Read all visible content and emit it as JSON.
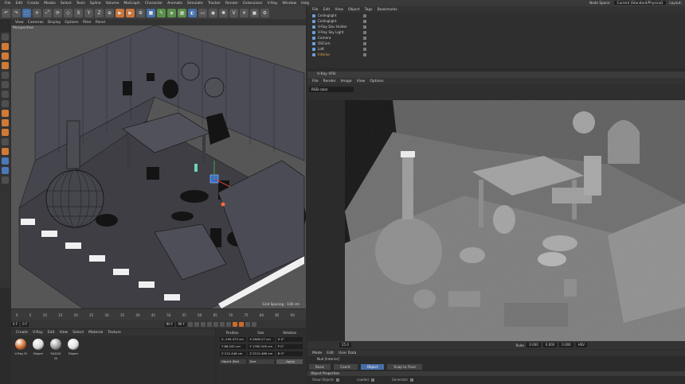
{
  "menu": [
    "File",
    "Edit",
    "Create",
    "Modes",
    "Select",
    "Tools",
    "Spline",
    "Volume",
    "MoGraph",
    "Character",
    "Animate",
    "Simulate",
    "Tracker",
    "Render",
    "Extensions",
    "V-Ray",
    "Window",
    "Help"
  ],
  "node_space": {
    "label": "Node Space:",
    "value": "Current (Standard/Physical)",
    "layout": "Layout:"
  },
  "toolbar": {
    "x": "X",
    "y": "Y",
    "z": "Z"
  },
  "viewport": {
    "menu": [
      "View",
      "Cameras",
      "Display",
      "Options",
      "Filter",
      "Panel"
    ],
    "title": "Perspective",
    "grid_spacing": "Grid Spacing : 100 cm"
  },
  "timeline": {
    "ticks": [
      "0",
      "5",
      "10",
      "15",
      "20",
      "25",
      "30",
      "35",
      "40",
      "45",
      "50",
      "55",
      "60",
      "65",
      "70",
      "75",
      "80",
      "85",
      "90"
    ],
    "start": "0 F",
    "cur": "0 F",
    "end": "90 F",
    "end2": "90 F"
  },
  "materials": {
    "menu": [
      "Create",
      "V-Ray",
      "Edit",
      "View",
      "Select",
      "Material",
      "Texture"
    ],
    "items": [
      {
        "name": "V-Ray M",
        "color": "#c86a2a"
      },
      {
        "name": "Diaper",
        "color": "#d8d8d8"
      },
      {
        "name": "SAXXX Gl",
        "color": "#9a9a9a"
      },
      {
        "name": "Diaper",
        "color": "#e0e0e0"
      }
    ]
  },
  "coords": {
    "headers": [
      "Position",
      "Size",
      "Rotation"
    ],
    "rows": [
      {
        "axis": "X",
        "pos": "-299.473 cm",
        "size": "2608.27 cm",
        "rot": "H 0°"
      },
      {
        "axis": "Y",
        "pos": "86.242 cm",
        "size": "1780.109 cm",
        "rot": "P 0°"
      },
      {
        "axis": "Z",
        "pos": "212.446 cm",
        "size": "2512.486 cm",
        "rot": "B 0°"
      }
    ],
    "mode": "Object (Rel)",
    "size_mode": "Size",
    "apply": "Apply"
  },
  "objects": {
    "menu": [
      "File",
      "Edit",
      "View",
      "Object",
      "Tags",
      "Bookmarks"
    ],
    "items": [
      {
        "name": "Ceilinglight",
        "selected": false
      },
      {
        "name": "Ceilinglight",
        "selected": false
      },
      {
        "name": "V-Ray Dev Holder",
        "selected": false
      },
      {
        "name": "V-Ray Sky Light",
        "selected": false
      },
      {
        "name": "Camera",
        "selected": false
      },
      {
        "name": "OSCam",
        "selected": false
      },
      {
        "name": "Loft",
        "selected": false
      },
      {
        "name": "Interior",
        "selected": true
      }
    ]
  },
  "vfb": {
    "title": "V-Ray VFB",
    "menu": [
      "File",
      "Render",
      "Image",
      "View",
      "Options"
    ],
    "channel": "RGB color",
    "status": {
      "zoom": "25.0",
      "mode": "Rules",
      "v1": "0.000",
      "v2": "0.000",
      "v3": "0.000",
      "hsv": "HSV"
    }
  },
  "attributes": {
    "menu": [
      "Mode",
      "Edit",
      "User Data"
    ],
    "object": "Null [Interior]",
    "tabs": [
      {
        "label": "Basic",
        "active": false
      },
      {
        "label": "Coord.",
        "active": false
      },
      {
        "label": "Object",
        "active": true
      },
      {
        "label": "Snap to Floor",
        "active": false
      }
    ],
    "section": "Object Properties",
    "rows": [
      "Show Objects",
      "Loaded",
      "Generator"
    ]
  }
}
